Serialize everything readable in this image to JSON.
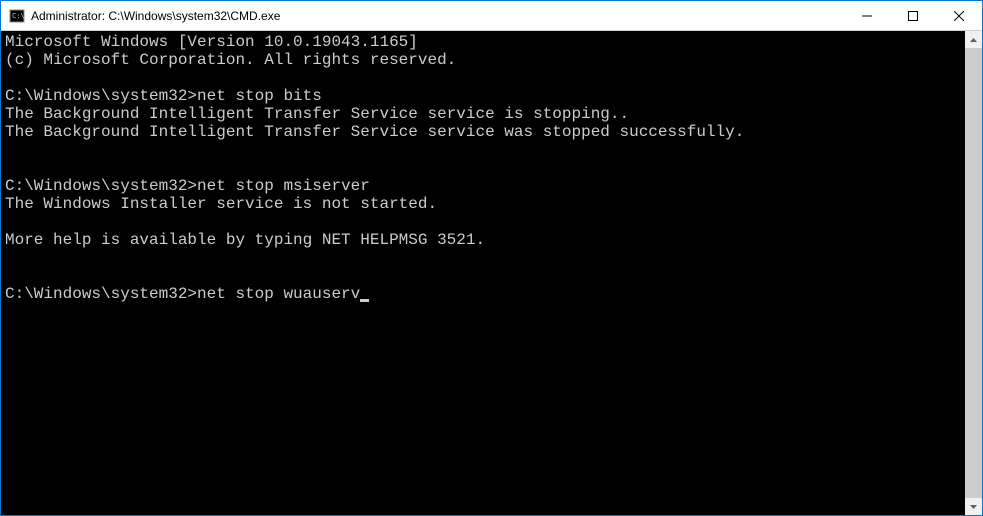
{
  "window": {
    "title": "Administrator: C:\\Windows\\system32\\CMD.exe"
  },
  "terminal": {
    "lines": [
      {
        "type": "output",
        "text": "Microsoft Windows [Version 10.0.19043.1165]"
      },
      {
        "type": "output",
        "text": "(c) Microsoft Corporation. All rights reserved."
      },
      {
        "type": "blank",
        "text": ""
      },
      {
        "type": "prompt",
        "prompt": "C:\\Windows\\system32>",
        "command": "net stop bits"
      },
      {
        "type": "output",
        "text": "The Background Intelligent Transfer Service service is stopping.."
      },
      {
        "type": "output",
        "text": "The Background Intelligent Transfer Service service was stopped successfully."
      },
      {
        "type": "blank",
        "text": ""
      },
      {
        "type": "blank",
        "text": ""
      },
      {
        "type": "prompt",
        "prompt": "C:\\Windows\\system32>",
        "command": "net stop msiserver"
      },
      {
        "type": "output",
        "text": "The Windows Installer service is not started."
      },
      {
        "type": "blank",
        "text": ""
      },
      {
        "type": "output",
        "text": "More help is available by typing NET HELPMSG 3521."
      },
      {
        "type": "blank",
        "text": ""
      },
      {
        "type": "blank",
        "text": ""
      },
      {
        "type": "prompt-active",
        "prompt": "C:\\Windows\\system32>",
        "command": "net stop wuauserv"
      }
    ]
  }
}
